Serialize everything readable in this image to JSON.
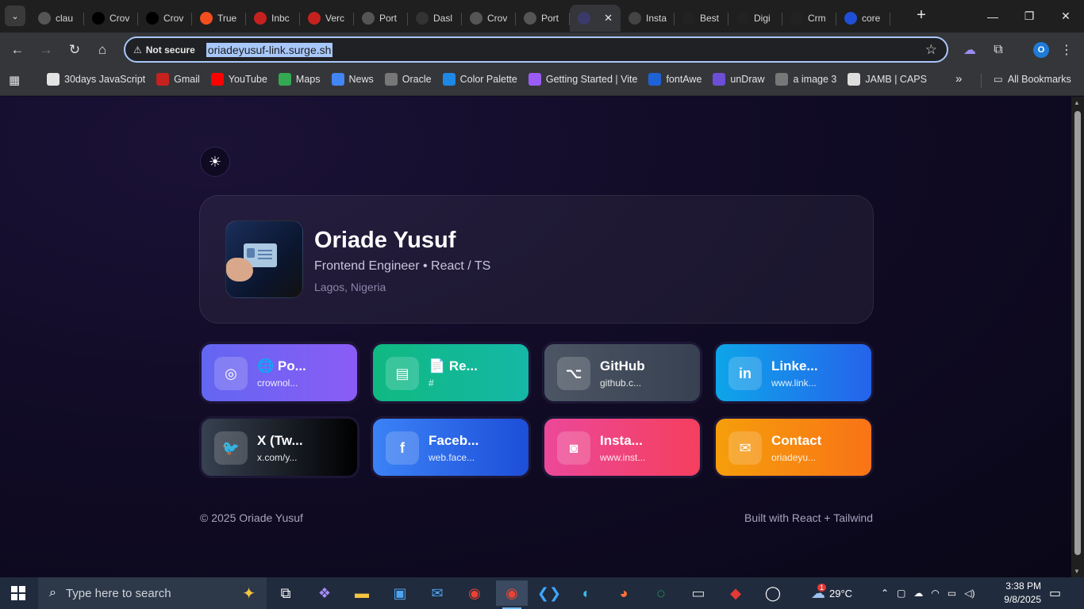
{
  "browser": {
    "tabs": [
      {
        "title": "clau",
        "icon": "globe-icon",
        "color": "#555"
      },
      {
        "title": "Crov",
        "icon": "github-icon",
        "color": "#000"
      },
      {
        "title": "Crov",
        "icon": "github-icon",
        "color": "#000"
      },
      {
        "title": "True",
        "icon": "figma-icon",
        "color": "#f24e1e"
      },
      {
        "title": "Inbc",
        "icon": "gmail-icon",
        "color": "#c5221f"
      },
      {
        "title": "Verc",
        "icon": "gmail-icon",
        "color": "#c5221f"
      },
      {
        "title": "Port",
        "icon": "globe-icon",
        "color": "#555"
      },
      {
        "title": "Dasl",
        "icon": "dashboard-icon",
        "color": "#333"
      },
      {
        "title": "Crov",
        "icon": "globe-icon",
        "color": "#555"
      },
      {
        "title": "Port",
        "icon": "globe-icon",
        "color": "#555"
      },
      {
        "title": "",
        "icon": "site-icon",
        "color": "#3a3a6a",
        "active": true
      },
      {
        "title": "Insta",
        "icon": "openai-icon",
        "color": "#444"
      },
      {
        "title": "Best",
        "icon": "site-icon",
        "color": "#222"
      },
      {
        "title": "Digi",
        "icon": "is-icon",
        "color": "#222"
      },
      {
        "title": "Crm",
        "icon": "is-icon",
        "color": "#222"
      },
      {
        "title": "core",
        "icon": "site-icon",
        "color": "#1e4fd6"
      }
    ],
    "security_label": "Not secure",
    "url": "oriadeyusuf-link.surge.sh",
    "profile_initial": "O",
    "bookmarks": [
      {
        "label": "30days JavaScript",
        "icon": "folder-icon",
        "color": "#e3e3e3"
      },
      {
        "label": "Gmail",
        "icon": "gmail-icon",
        "color": "#c5221f"
      },
      {
        "label": "YouTube",
        "icon": "youtube-icon",
        "color": "#ff0000"
      },
      {
        "label": "Maps",
        "icon": "maps-icon",
        "color": "#34a853"
      },
      {
        "label": "News",
        "icon": "news-icon",
        "color": "#4285f4"
      },
      {
        "label": "Oracle",
        "icon": "globe-icon",
        "color": "#777"
      },
      {
        "label": "Color Palette",
        "icon": "palette-icon",
        "color": "#1e88e5"
      },
      {
        "label": "Getting Started | Vite",
        "icon": "vite-icon",
        "color": "#9b5cf6"
      },
      {
        "label": "fontAwe",
        "icon": "flag-icon",
        "color": "#1e63d6"
      },
      {
        "label": "unDraw",
        "icon": "undraw-icon",
        "color": "#6c4fd6"
      },
      {
        "label": "a image 3",
        "icon": "globe-icon",
        "color": "#777"
      },
      {
        "label": "JAMB | CAPS",
        "icon": "document-icon",
        "color": "#ddd"
      }
    ],
    "all_bookmarks_label": "All Bookmarks"
  },
  "profile": {
    "name": "Oriade Yusuf",
    "role": "Frontend Engineer • React / TS",
    "location": "Lagos, Nigeria"
  },
  "links": [
    {
      "title": "🌐 Po...",
      "subtitle": "crownol...",
      "icon": "globe-icon",
      "glyph": "◎",
      "gradient": [
        "#6366f1",
        "#8b5cf6"
      ]
    },
    {
      "title": "📄 Re...",
      "subtitle": "#",
      "icon": "document-icon",
      "glyph": "▤",
      "gradient": [
        "#10b981",
        "#14b8a6"
      ]
    },
    {
      "title": "GitHub",
      "subtitle": "github.c...",
      "icon": "github-icon",
      "glyph": "⌥",
      "gradient": [
        "#4b5563",
        "#374151"
      ]
    },
    {
      "title": "Linke...",
      "subtitle": "www.link...",
      "icon": "linkedin-icon",
      "glyph": "in",
      "gradient": [
        "#0ea5e9",
        "#2563eb"
      ]
    },
    {
      "title": "X (Tw...",
      "subtitle": "x.com/y...",
      "icon": "twitter-icon",
      "glyph": "🐦",
      "gradient": [
        "#374151",
        "#000000"
      ]
    },
    {
      "title": "Faceb...",
      "subtitle": "web.face...",
      "icon": "facebook-icon",
      "glyph": "f",
      "gradient": [
        "#3b82f6",
        "#1d4ed8"
      ]
    },
    {
      "title": "Insta...",
      "subtitle": "www.inst...",
      "icon": "instagram-icon",
      "glyph": "◙",
      "gradient": [
        "#ec4899",
        "#f43f5e"
      ]
    },
    {
      "title": "Contact",
      "subtitle": "oriadeyu...",
      "icon": "mail-icon",
      "glyph": "✉",
      "gradient": [
        "#f59e0b",
        "#f97316"
      ]
    }
  ],
  "footer": {
    "copyright": "© 2025 Oriade Yusuf",
    "built_with": "Built with React + Tailwind"
  },
  "taskbar": {
    "search_placeholder": "Type here to search",
    "weather": "29°C",
    "weather_badge": "1",
    "time": "3:38 PM",
    "date": "9/8/2025"
  }
}
